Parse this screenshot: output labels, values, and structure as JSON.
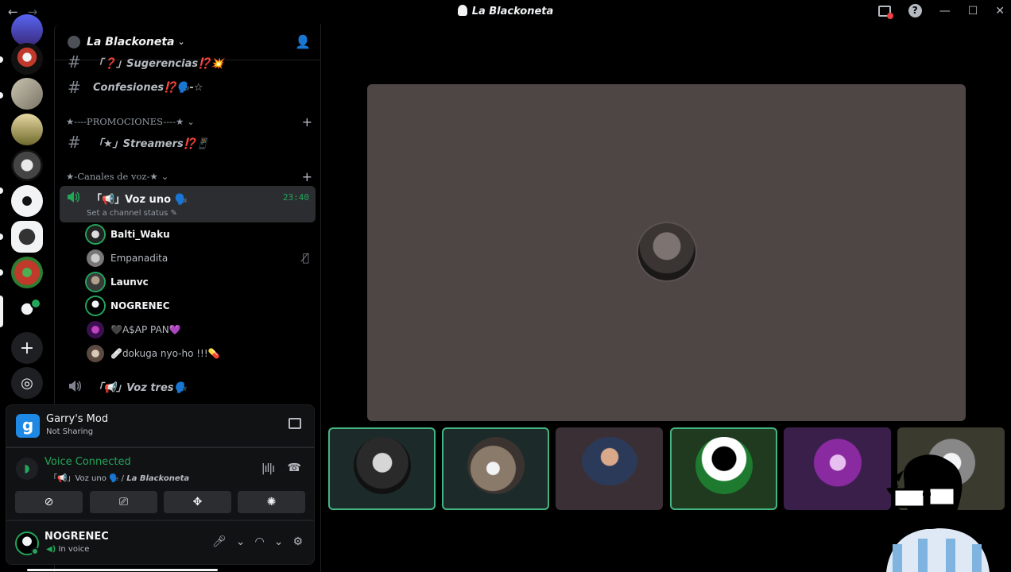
{
  "titlebar": {
    "back": "←",
    "forward": "→",
    "title": "La Blackoneta",
    "inbox_icon": "inbox-icon",
    "help_label": "?",
    "minimize": "—",
    "maximize": "☐",
    "close": "✕"
  },
  "rail": {
    "add_server": "+",
    "discover": "◎"
  },
  "guild": {
    "name": "La Blackoneta",
    "chevron": "⌄"
  },
  "channels": {
    "sugerencias": "「❓」Sugerencias⁉️💥",
    "confesiones": "Confesiones⁉️🗣️-☆",
    "cat_promociones": "★----PROMOCIONES----★",
    "streamers": "「★」Streamers⁉️📱",
    "cat_voz": "★-Canales de voz-★",
    "voz_tres": "「📢」Voz tres🗣️"
  },
  "voice_channel": {
    "name": "「📢」Voz uno 🗣️",
    "timer": "23:40",
    "status_placeholder": "Set a channel status ✎",
    "users": [
      {
        "name": "Balti_Waku",
        "speaking": true
      },
      {
        "name": "Empanadita",
        "speaking": false
      },
      {
        "name": "Launvc",
        "speaking": true
      },
      {
        "name": "NOGRENEC",
        "speaking": true
      },
      {
        "name": "🖤A$AP PAN💜",
        "speaking": false
      },
      {
        "name": "🩹dokuga nyo-ho !!!💊",
        "speaking": false
      }
    ]
  },
  "activity": {
    "game_letter": "g",
    "title": "Garry's Mod",
    "subtitle": "Not Sharing"
  },
  "voice_panel": {
    "status": "Voice Connected",
    "location_channel": "「📢」Voz uno 🗣️",
    "location_server": "La Blackoneta"
  },
  "user": {
    "name": "NOGRENEC",
    "status": "In voice"
  },
  "colors": {
    "green": "#23a55a",
    "stage_bg": "#4e4645"
  }
}
